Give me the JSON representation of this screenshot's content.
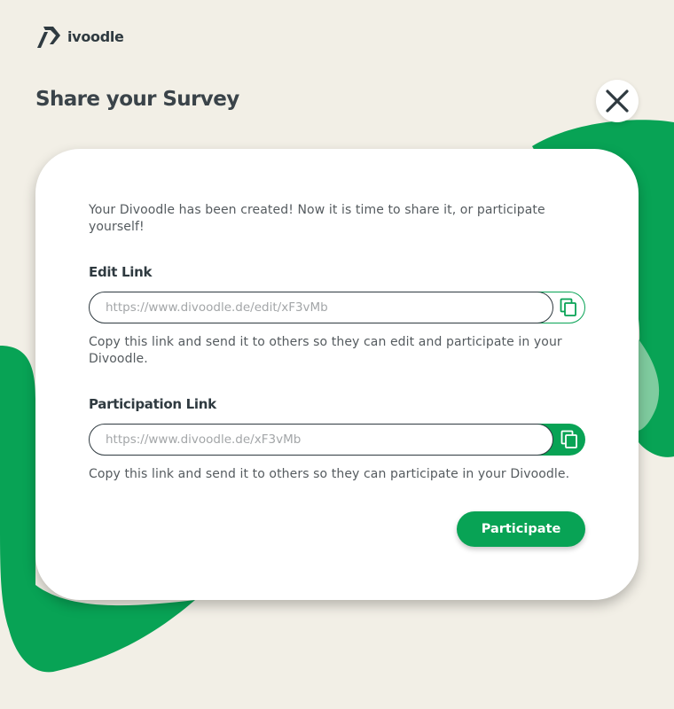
{
  "brand": {
    "name": "ivoodle",
    "accent": "#08a355",
    "logo_icon": "divoodle-d-logo-icon"
  },
  "page": {
    "title": "Share your Survey",
    "close_icon": "close-icon"
  },
  "card": {
    "intro": "Your Divoodle has been created! Now it is time to share it, or participate yourself!",
    "edit": {
      "label": "Edit Link",
      "url": "https://www.divoodle.de/edit/xF3vMb",
      "help": "Copy this link and send it to others so they can edit and participate in your Divoodle.",
      "copy_icon": "copy-icon"
    },
    "participation": {
      "label": "Participation Link",
      "url": "https://www.divoodle.de/xF3vMb",
      "help": "Copy this link and send it to others so they can participate in your Divoodle.",
      "copy_icon": "copy-icon"
    },
    "participate_label": "Participate"
  }
}
